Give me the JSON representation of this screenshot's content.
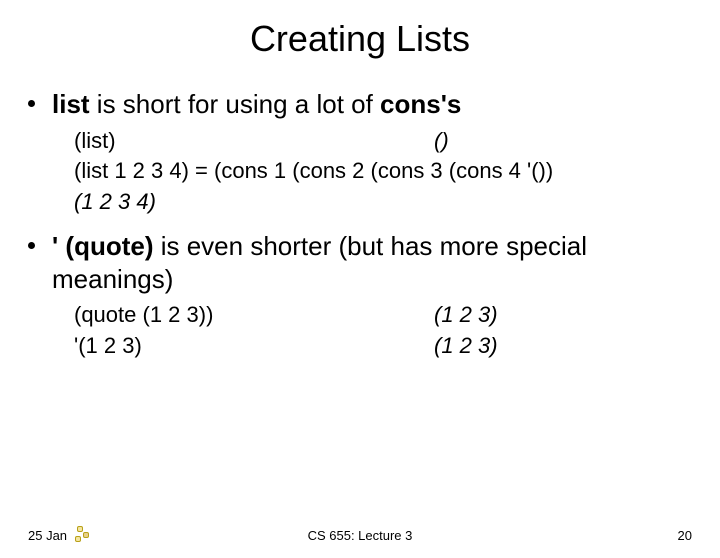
{
  "title": "Creating Lists",
  "bullet1": {
    "prefix": "list",
    "mid": " is short for using a lot of ",
    "suffix": "cons's"
  },
  "examples1": {
    "row1_left": "(list)",
    "row1_right": "()",
    "line2": "(list 1 2 3 4) = (cons 1 (cons 2 (cons 3 (cons 4 '())",
    "line3": "(1 2 3 4)"
  },
  "bullet2": {
    "prefix": "' (quote)",
    "rest": " is even shorter (but has more special meanings)"
  },
  "examples2": {
    "row1_left": "(quote (1 2 3))",
    "row1_right": "(1 2 3)",
    "row2_left": "'(1 2 3)",
    "row2_right": "(1 2 3)"
  },
  "footer": {
    "left": "25 Jan",
    "center": "CS 655: Lecture 3",
    "right": "20"
  }
}
